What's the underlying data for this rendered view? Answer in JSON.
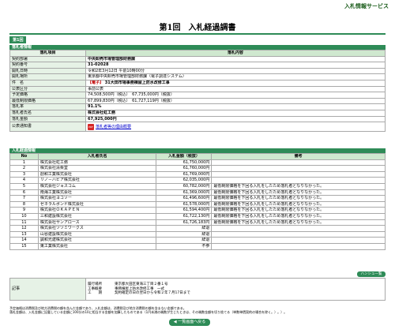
{
  "service_title": "入札情報サービス",
  "page_title": "第1回　入札経過調書",
  "round_tab": "第1回",
  "section1": {
    "heading": "落札者情報",
    "col_item": "落札項目",
    "col_content": "落札内容",
    "rows": [
      {
        "label": "契約部署",
        "value": "中央卸売市場管理部財務課"
      },
      {
        "label": "契約番号",
        "value": "31-02028"
      },
      {
        "label": "開札日時",
        "value": "令和2年3月12日 午前10時00分"
      },
      {
        "label": "開札場所",
        "value": "東京都中央卸売市場管理部財務課（電子調達システム）"
      },
      {
        "label": "件　名",
        "tag": "【電子】",
        "value": "31大田市場事務棟屋上防水改修工事"
      },
      {
        "label": "公表区分",
        "value": "事前公表"
      },
      {
        "label": "予定価格",
        "value": "74,508,500円（税込）　67,735,000円（税抜）"
      },
      {
        "label": "最低制限価格",
        "value": "67,899,830円（税込）　61,727,119円（税抜）"
      },
      {
        "label": "落札率",
        "value": "91.1%"
      },
      {
        "label": "落札者氏名",
        "value": "株式会社虹工務"
      },
      {
        "label": "落札金額",
        "value": "67,925,000円"
      },
      {
        "label": "公表通知書",
        "link": "落札者等の理由概要"
      }
    ]
  },
  "section2": {
    "heading": "入札経過情報",
    "col_no": "No",
    "col_bidder": "入札者氏名",
    "col_amount": "入札金額（税抜）",
    "col_remarks": "備考",
    "rows": [
      {
        "no": "1",
        "bidder": "株式会社虹工務",
        "amount": "61,750,000円",
        "remarks": ""
      },
      {
        "no": "2",
        "bidder": "株式会社清栗堂",
        "amount": "61,760,000円",
        "remarks": ""
      },
      {
        "no": "3",
        "bidder": "創和工業株式会社",
        "amount": "61,769,000円",
        "remarks": ""
      },
      {
        "no": "4",
        "bidder": "リノ－ハビア株式会社",
        "amount": "62,035,000円",
        "remarks": ""
      },
      {
        "no": "5",
        "bidder": "株式会社ジョスコム",
        "amount": "60,782,000円",
        "remarks": "最低制限価格を下回る入札をしたため落札者となりなかった。"
      },
      {
        "no": "6",
        "bidder": "南海工業株式会社",
        "amount": "61,369,000円",
        "remarks": "最低制限価格を下回る入札をしたため落札者となりなかった。"
      },
      {
        "no": "7",
        "bidder": "株式会社ヨコソー",
        "amount": "61,496,600円",
        "remarks": "最低制限価格を下回る入札をしたため落札者となりなかった。"
      },
      {
        "no": "8",
        "bidder": "ゼネラルボンド株式会社",
        "amount": "61,578,000円",
        "remarks": "最低制限価格を下回る入札をしたため落札者となりなかった。"
      },
      {
        "no": "9",
        "bidder": "株式会社ＯＫＡＰＥＮ",
        "amount": "61,594,400円",
        "remarks": "最低制限価格を下回る入札をしたため落札者となりなかった。"
      },
      {
        "no": "10",
        "bidder": "三和建設株式会社",
        "amount": "61,722,130円",
        "remarks": "最低制限価格を下回る入札をしたため落札者となりなかった。"
      },
      {
        "no": "11",
        "bidder": "株式会社サンアロース",
        "amount": "61,726,183円",
        "remarks": "最低制限価格を下回る入札をしたため落札者となりなかった。"
      },
      {
        "no": "12",
        "bidder": "株式会社ツツミワークス",
        "amount": "辞退",
        "remarks": ""
      },
      {
        "no": "13",
        "bidder": "山谷建設株式会社",
        "amount": "辞退",
        "remarks": ""
      },
      {
        "no": "14",
        "bidder": "誠和光建株式会社",
        "amount": "辞退",
        "remarks": ""
      },
      {
        "no": "15",
        "bidder": "東工業株式会社",
        "amount": "不参",
        "remarks": ""
      }
    ]
  },
  "paper_button": "ハンシュ一覧",
  "notes": {
    "label": "記事",
    "lines": [
      {
        "k": "履行場所",
        "v": "東京都大田区東海三丁目２番１号"
      },
      {
        "k": "工事概要",
        "v": "事務棟屋上防水改修工事　一式"
      },
      {
        "k": "工　　期",
        "v": "契約確定の日の翌日から令和２年７月17日まで"
      }
    ]
  },
  "footnotes": [
    "予定価格は消費税及び地方消費税の額を含んだ金額であり、入札金額は、消費税及び地方消費税の額を含まない金額である。",
    "落札金額は、入札金額に記載している金額に100分の10に相当する金額を加算したものである（1円未満の端数が生じたときは、その端数金額を切り捨てる（単数単價契約の場合を除く。）。）。"
  ],
  "back_button": "◀ 一覧画面へ戻る"
}
